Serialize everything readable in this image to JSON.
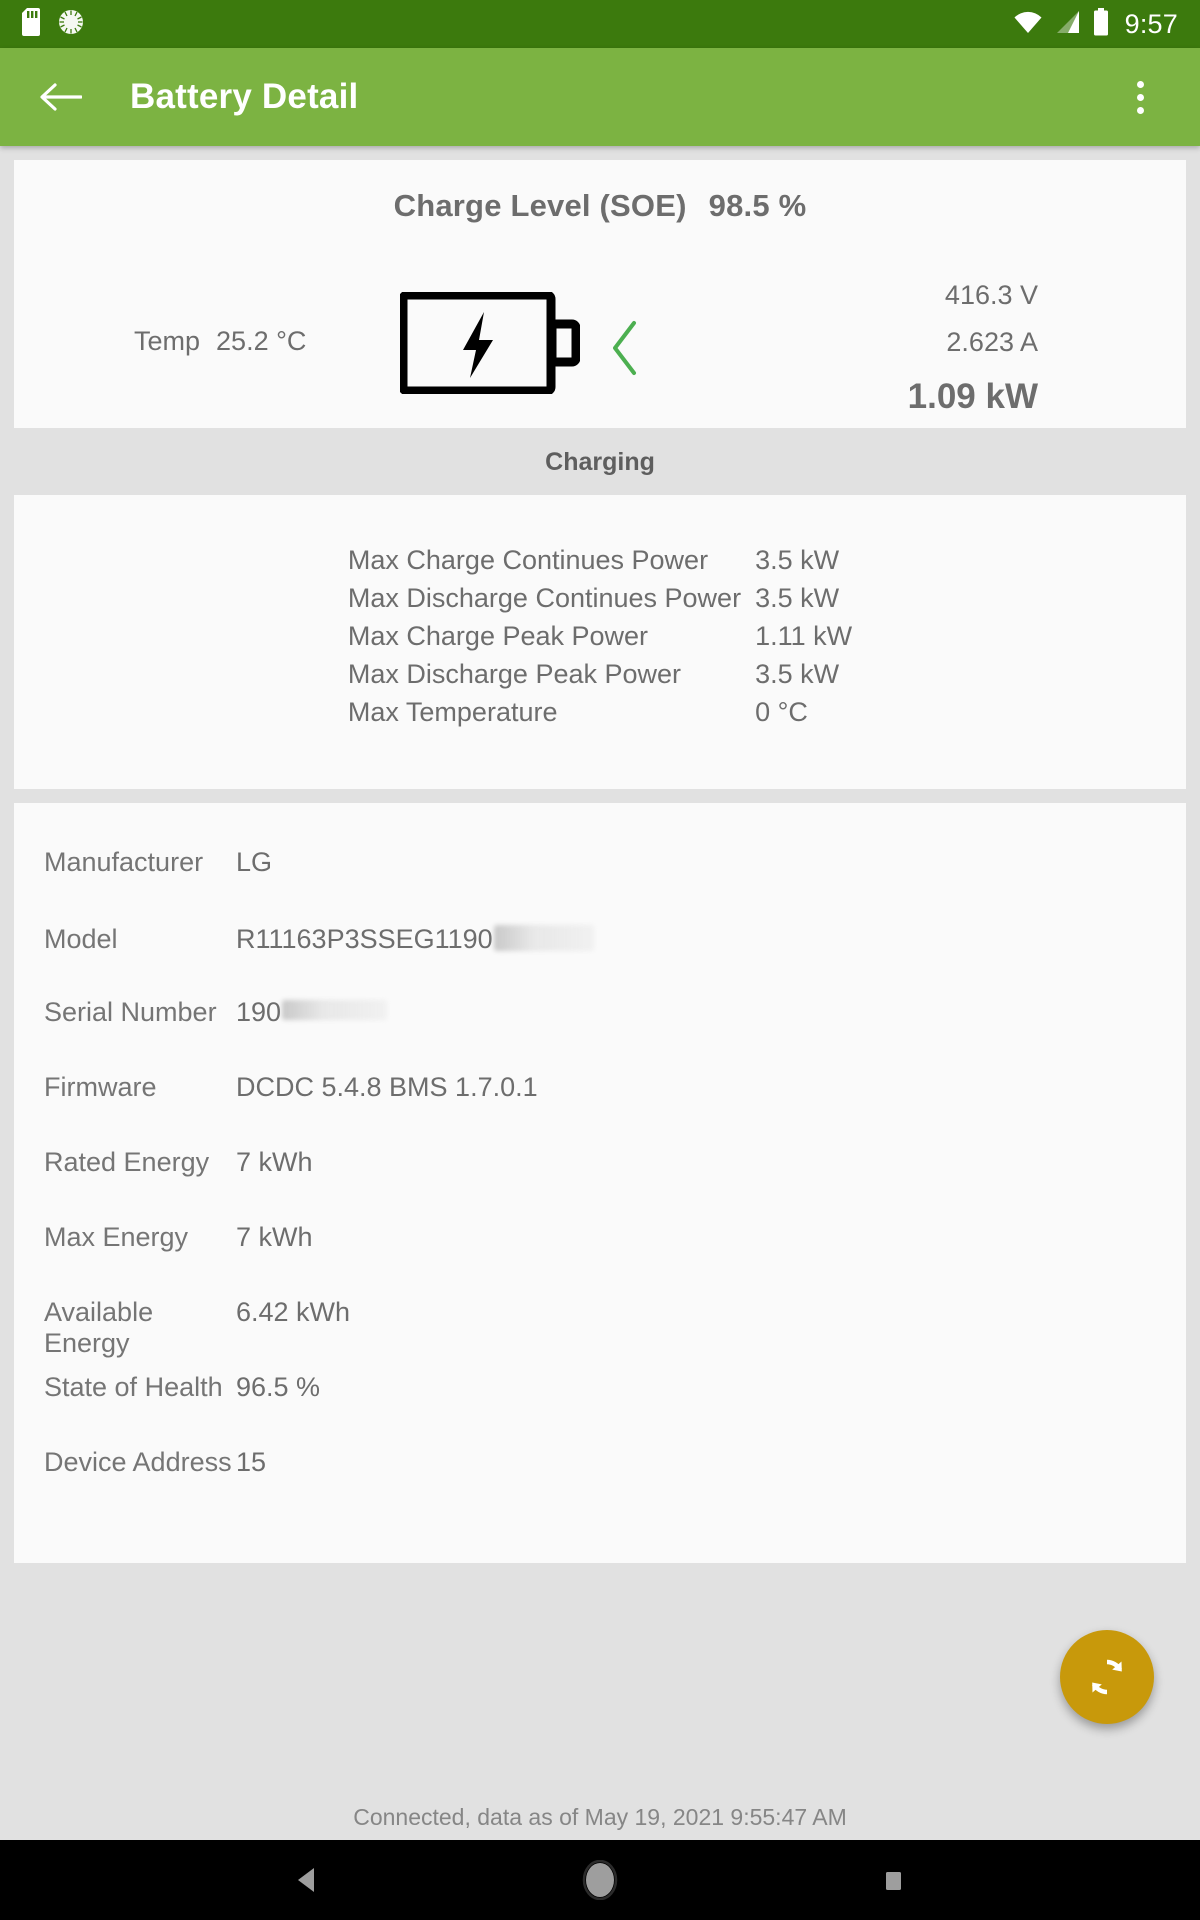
{
  "statusbar": {
    "time": "9:57",
    "icons": [
      "sd-card-icon",
      "sync-circle-icon",
      "wifi-icon",
      "cellular-signal-icon",
      "battery-icon"
    ]
  },
  "appbar": {
    "back_label": "back-arrow",
    "title": "Battery Detail",
    "overflow_label": "more-options"
  },
  "summary": {
    "soe_label": "Charge Level (SOE)",
    "soe_value": "98.5 %",
    "temp_label": "Temp",
    "temp_value": "25.2 °C",
    "voltage": "416.3 V",
    "current": "2.623 A",
    "power": "1.09 kW",
    "battery_icon": "battery-charging-icon",
    "direction_icon": "chevron-left-icon",
    "direction_color": "#4caf50"
  },
  "section": {
    "charging_label": "Charging"
  },
  "specs": [
    {
      "label": "Max Charge Continues Power",
      "value": "3.5 kW"
    },
    {
      "label": "Max Discharge Continues Power",
      "value": "3.5 kW"
    },
    {
      "label": "Max Charge Peak Power",
      "value": "1.11 kW"
    },
    {
      "label": "Max Discharge Peak Power",
      "value": "3.5 kW"
    },
    {
      "label": "Max Temperature",
      "value": "0 °C"
    }
  ],
  "details": [
    {
      "label": "Manufacturer",
      "value": "LG",
      "redacted": "none"
    },
    {
      "label": "Model",
      "value": "R11163P3SSEG1190",
      "redacted": "model"
    },
    {
      "label": "Serial Number",
      "value": "190",
      "redacted": "serial"
    },
    {
      "label": "Firmware",
      "value": "DCDC 5.4.8 BMS 1.7.0.1",
      "redacted": "none"
    },
    {
      "label": "Rated Energy",
      "value": "7 kWh",
      "redacted": "none"
    },
    {
      "label": "Max Energy",
      "value": "7 kWh",
      "redacted": "none"
    },
    {
      "label": "Available Energy",
      "value": "6.42 kWh",
      "redacted": "none"
    },
    {
      "label": "State of Health",
      "value": "96.5 %",
      "redacted": "none"
    },
    {
      "label": "Device Address",
      "value": "15",
      "redacted": "none"
    }
  ],
  "fab": {
    "icon": "refresh-icon",
    "color": "#c8990b"
  },
  "bottom_status": {
    "text": "Connected, data as of May 19, 2021 9:55:47 AM"
  },
  "navbar": {
    "back": "nav-back-icon",
    "home": "nav-home-icon",
    "recents": "nav-recents-icon"
  },
  "theme": {
    "statusbar_bg": "#3c7a0d",
    "appbar_bg": "#7cb342",
    "page_bg": "#e1e1e1",
    "card_bg": "#fafafa",
    "text_muted": "#6d6d6d"
  }
}
